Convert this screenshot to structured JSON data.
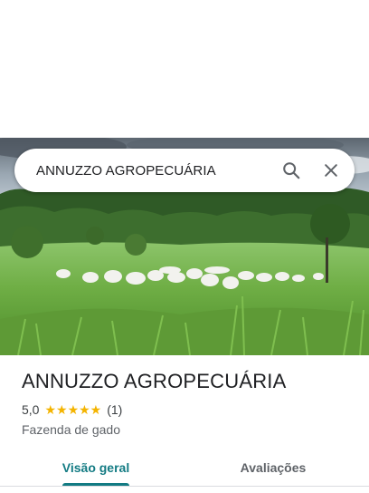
{
  "search": {
    "query": "ANNUZZO AGROPECUÁRIA",
    "search_icon": "search-icon",
    "close_icon": "close-icon"
  },
  "hero": {
    "description_icon": "photo"
  },
  "place": {
    "name": "ANNUZZO AGROPECUÁRIA",
    "rating": "5,0",
    "stars": "★★★★★",
    "review_count": "(1)",
    "category": "Fazenda de gado"
  },
  "tabs": [
    {
      "label": "Visão geral",
      "active": true
    },
    {
      "label": "Avaliações",
      "active": false
    }
  ],
  "colors": {
    "accent": "#137b83",
    "star": "#f4b400"
  }
}
